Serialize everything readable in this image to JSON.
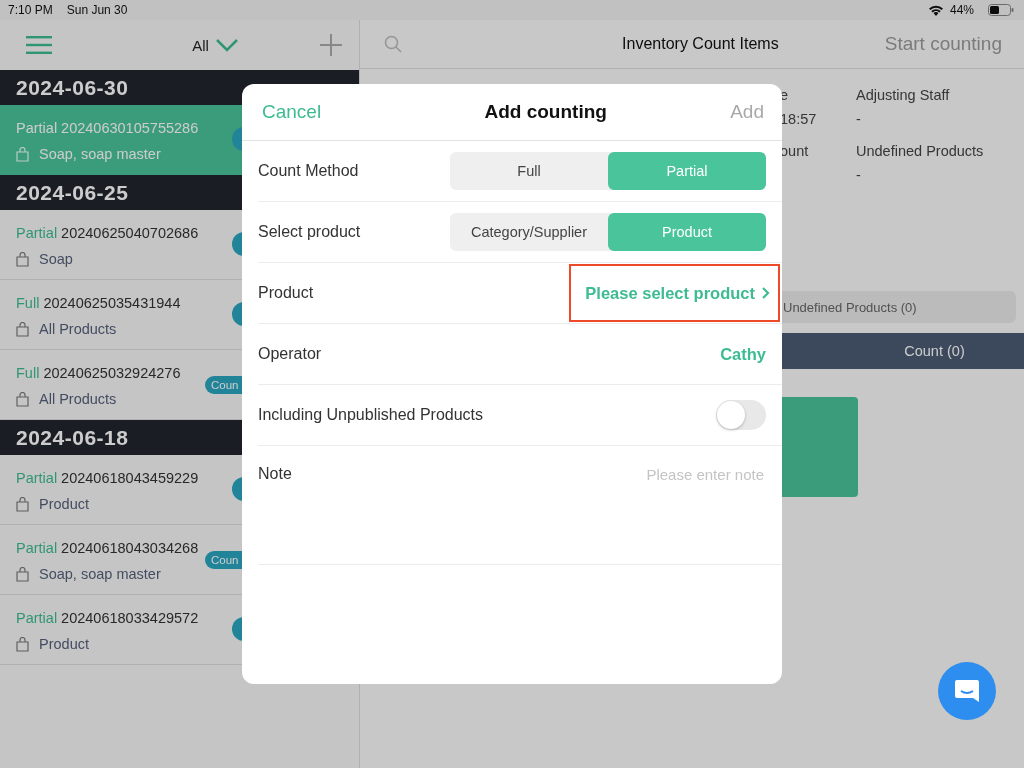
{
  "status_bar": {
    "time": "7:10 PM",
    "date": "Sun Jun 30",
    "battery": "44%"
  },
  "sidebar": {
    "filter": "All",
    "groups": [
      {
        "date": "2024-06-30",
        "items": [
          {
            "method": "Partial",
            "number": "20240630105755286",
            "products": "Soap, soap master",
            "selected": true,
            "badge": {
              "kind": "circle"
            }
          }
        ]
      },
      {
        "date": "2024-06-25",
        "items": [
          {
            "method": "Partial",
            "number": "20240625040702686",
            "products": "Soap",
            "selected": false,
            "badge": {
              "kind": "circle"
            }
          },
          {
            "method": "Full",
            "number": "20240625035431944",
            "products": "All Products",
            "selected": false,
            "badge": {
              "kind": "circle"
            }
          },
          {
            "method": "Full",
            "number": "20240625032924276",
            "products": "All Products",
            "selected": false,
            "badge": {
              "kind": "pill",
              "text": "Coun"
            }
          }
        ]
      },
      {
        "date": "2024-06-18",
        "items": [
          {
            "method": "Partial",
            "number": "20240618043459229",
            "products": "Product",
            "selected": false,
            "badge": {
              "kind": "circle"
            }
          },
          {
            "method": "Partial",
            "number": "20240618043034268",
            "products": "Soap, soap master",
            "selected": false,
            "badge": {
              "kind": "pill",
              "text": "Coun"
            }
          },
          {
            "method": "Partial",
            "number": "20240618033429572",
            "products": "Product",
            "selected": false,
            "badge": {
              "kind": "circle"
            }
          }
        ]
      }
    ]
  },
  "detail": {
    "title": "Inventory Count Items",
    "action": "Start counting",
    "fields": [
      {
        "label": "e",
        "value": "18:57"
      },
      {
        "label": "Adjusting Staff",
        "value": "-"
      },
      {
        "label": "ount"
      },
      {
        "label": "Undefined Products",
        "value": "-"
      }
    ],
    "filter_tab": "Undefined Products (0)",
    "count_bar": "Count (0)"
  },
  "modal": {
    "cancel": "Cancel",
    "title": "Add counting",
    "add": "Add",
    "add_disabled": true,
    "rows": [
      {
        "kind": "segmented",
        "label": "Count Method",
        "options": [
          {
            "label": "Full",
            "selected": false
          },
          {
            "label": "Partial",
            "selected": true
          }
        ]
      },
      {
        "kind": "segmented",
        "label": "Select product",
        "options": [
          {
            "label": "Category/Supplier",
            "selected": false
          },
          {
            "label": "Product",
            "selected": true
          }
        ]
      },
      {
        "kind": "link",
        "label": "Product",
        "value": "Please select product",
        "highlighted": true
      },
      {
        "kind": "value",
        "label": "Operator",
        "value": "Cathy"
      },
      {
        "kind": "toggle",
        "label": "Including Unpublished Products",
        "on": false
      },
      {
        "kind": "note",
        "label": "Note",
        "placeholder": "Please enter note"
      }
    ]
  }
}
